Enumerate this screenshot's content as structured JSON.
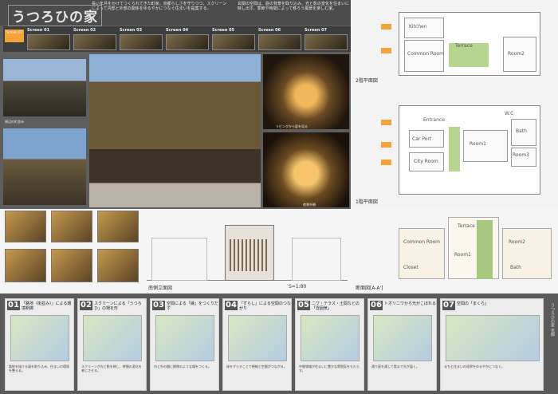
{
  "header": {
    "title": "うつろひの家",
    "concept_left": "長い年月をかけてつくられてきた町家。京都らしさを守りつつ、スクリーンによって内部と外部の関係をゆるやかにつなぐ住まいを提案する。",
    "concept_right": "玄関の空間は、庭の背景を取り込み、光と影の変化を住まいに映し出す。季節や時間によって移ろう風景を楽しむ家。"
  },
  "screens": {
    "tag": "Screen 01",
    "cards": [
      "Screen 01",
      "Screen 02",
      "Screen 03",
      "Screen 04",
      "Screen 05",
      "Screen 06",
      "Screen 07"
    ]
  },
  "photos": {
    "cap_street": "周辺の町並み",
    "cap_night1": "リビングから庭を見る",
    "cap_night2": "夜景外観"
  },
  "plans": {
    "upper_label": "2階平面図",
    "lower_label": "1階平面図",
    "rooms_upper": [
      "Kitchen",
      "Common Room",
      "Terrace",
      "Room2"
    ],
    "rooms_lower": [
      "Entrance",
      "W.C",
      "Bath",
      "Car Port",
      "Room1",
      "Room3",
      "City Room"
    ]
  },
  "elevation": {
    "south_label": "南側立面図",
    "scale_label": "S=1:80",
    "section_label": "断面図[A-A']",
    "section_rooms": [
      "Terrace",
      "Common Room",
      "Room2",
      "Room1",
      "Closet",
      "Bath"
    ]
  },
  "steps": [
    {
      "num": "01",
      "title": "「路地（街並み）」による環境制御",
      "text": "路地を抜ける風を取り込み、住まいの環境を整える。"
    },
    {
      "num": "02",
      "title": "スクリーンによる「うつろひ」の場を形",
      "text": "スクリーンが光と影を映し、時間の変化を感じさせる。"
    },
    {
      "num": "03",
      "title": "空間による「縁」をつくりだす",
      "text": "内と外の間に縁側のような場をつくる。"
    },
    {
      "num": "04",
      "title": "「ずらし」による空間のつながり",
      "text": "床をずらすことで視線と空間がつながる。"
    },
    {
      "num": "05",
      "title": "ニワ・テラス・土間などの「雰囲気」",
      "text": "中間領域が住まいに豊かな雰囲気をもたらす。"
    },
    {
      "num": "06",
      "title": "トオリニワから光がこぼれる",
      "text": "通り庭を通して奥まで光が届く。"
    },
    {
      "num": "07",
      "title": "空間の「まくら」",
      "text": "まちと住まいの境界をゆるやかにつなぐ。"
    }
  ],
  "side_text": "うつろひの家 京都"
}
